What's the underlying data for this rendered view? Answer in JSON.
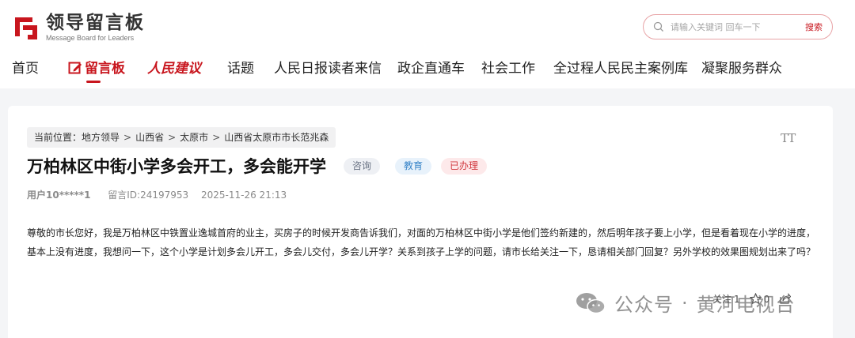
{
  "header": {
    "logo_title": "领导留言板",
    "logo_subtitle": "Message Board for Leaders",
    "search": {
      "placeholder": "请输入关键词 回车一下",
      "button": "搜索"
    },
    "colors": {
      "brand": "#c8161e"
    }
  },
  "nav": {
    "items": [
      {
        "label": "首页"
      },
      {
        "label": "留言板",
        "icon": "edit-icon",
        "active": true
      },
      {
        "label": "人民建议"
      },
      {
        "label": "话题"
      },
      {
        "label": "人民日报读者来信"
      },
      {
        "label": "政企直通车"
      },
      {
        "label": "社会工作"
      },
      {
        "label": "全过程人民民主案例库"
      },
      {
        "label": "凝聚服务群众"
      }
    ]
  },
  "breadcrumb": {
    "prefix": "当前位置：",
    "items": [
      "地方领导",
      "山西省",
      "太原市",
      "山西省太原市市长范兆森"
    ],
    "separator": ">"
  },
  "post": {
    "title": "万柏林区中街小学多会开工，多会能开学",
    "tags": [
      "咨询",
      "教育",
      "已办理"
    ],
    "user": "用户10*****1",
    "message_id": "留言ID:24197953",
    "datetime": "2025-11-26 21:13",
    "body": "尊敬的市长您好，我是万柏林区中铁置业逸城首府的业主，买房子的时候开发商告诉我们，对面的万柏林区中街小学是他们签约新建的，然后明年孩子要上小学，但是看着现在小学的进度，基本上没有进度，我想问一下，这个小学是计划多会儿开工，多会儿交付，多会儿开学？关系到孩子上学的问题，请市长给关注一下，恳请相关部门回复？另外学校的效果图规划出来了吗？",
    "font_toggle": "TT"
  },
  "actions": {
    "follow_label": "关注",
    "follow_count": "1",
    "favorite_count": "0"
  },
  "watermark": {
    "text1": "公众号",
    "dot": "·",
    "text2": "黄河电视台"
  }
}
